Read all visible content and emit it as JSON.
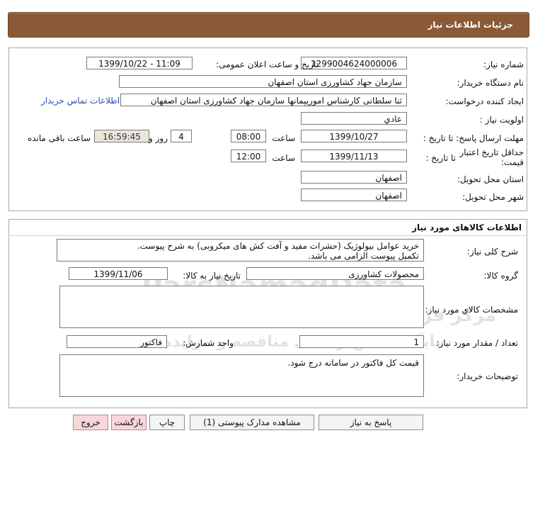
{
  "header": {
    "title": "جزئیات اطلاعات نیاز"
  },
  "watermark": {
    "brand": "ParsNamadData",
    "line1": "مرکز فراوری اطلاعات پارس نماد داده ها",
    "line2": "پایگاه اطلاع رسانی مناقصه و مزایده",
    "phone": "۰۲۱-۸۸۳۴۹۶۷۰-۵"
  },
  "info": {
    "need_number": {
      "label": "شماره نیاز:",
      "value": "1299004624000006"
    },
    "announce_datetime": {
      "label": "تاریخ و ساعت اعلان عمومی:",
      "value": "1399/10/22 - 11:09"
    },
    "buyer_org": {
      "label": "نام دستگاه خریدار:",
      "value": "سازمان جهاد کشاورزی استان اصفهان"
    },
    "requester": {
      "label": "ایجاد کننده درخواست:",
      "value": "ثنا سلطانی کارشناس اموریپمانها سازمان جهاد کشاورزی استان اصفهان"
    },
    "contact_link": "اطلاعات تماس خریدار",
    "priority": {
      "label": "اولویت نیاز :",
      "value": "عادي"
    },
    "reply_deadline": {
      "label": "مهلت ارسال پاسخ: تا تاریخ :",
      "date": "1399/10/27",
      "time_label": "ساعت",
      "time": "08:00",
      "days": "4",
      "days_label": "روز و",
      "remaining": "16:59:45",
      "remaining_label": "ساعت باقی مانده"
    },
    "price_validity": {
      "label": "حداقل تاریخ اعتبار قیمت:",
      "date_label": "تا تاریخ :",
      "date": "1399/11/13",
      "time_label": "ساعت",
      "time": "12:00"
    },
    "delivery_province": {
      "label": "استان محل تحویل:",
      "value": "اصفهان"
    },
    "delivery_city": {
      "label": "شهر محل تحویل:",
      "value": "اصفهان"
    }
  },
  "goods": {
    "title": "اطلاعات کالاهای مورد نیاز",
    "description": {
      "label": "شرح کلی نیاز:",
      "line1": "خرید عوامل بیولوژیک (حشرات مفید و آفت کش های میکروبی) به شرح پیوست.",
      "line2": "تکمیل پیوست الزامی می باشد."
    },
    "group": {
      "label": "گروه کالا:",
      "value": "محصولات کشاورزی"
    },
    "need_date": {
      "label": "تاریخ نیاز به کالا:",
      "value": "1399/11/06"
    },
    "specs": {
      "label": "مشخصات کالاي مورد نیاز:",
      "value": ""
    },
    "quantity": {
      "label": "تعداد / مقدار مورد نیاز:",
      "value": "1"
    },
    "unit": {
      "label": "واحد شمارش:",
      "value": "فاکتور"
    },
    "buyer_notes": {
      "label": "توضیحات خریدار:",
      "value": "قیمت کل فاکتور در سامانه درج شود."
    }
  },
  "buttons": {
    "reply": "پاسخ به نیاز",
    "attachments": "مشاهده مدارک پیوستی (1)",
    "print": "چاپ",
    "back": "بازگشت",
    "exit": "خروج"
  }
}
